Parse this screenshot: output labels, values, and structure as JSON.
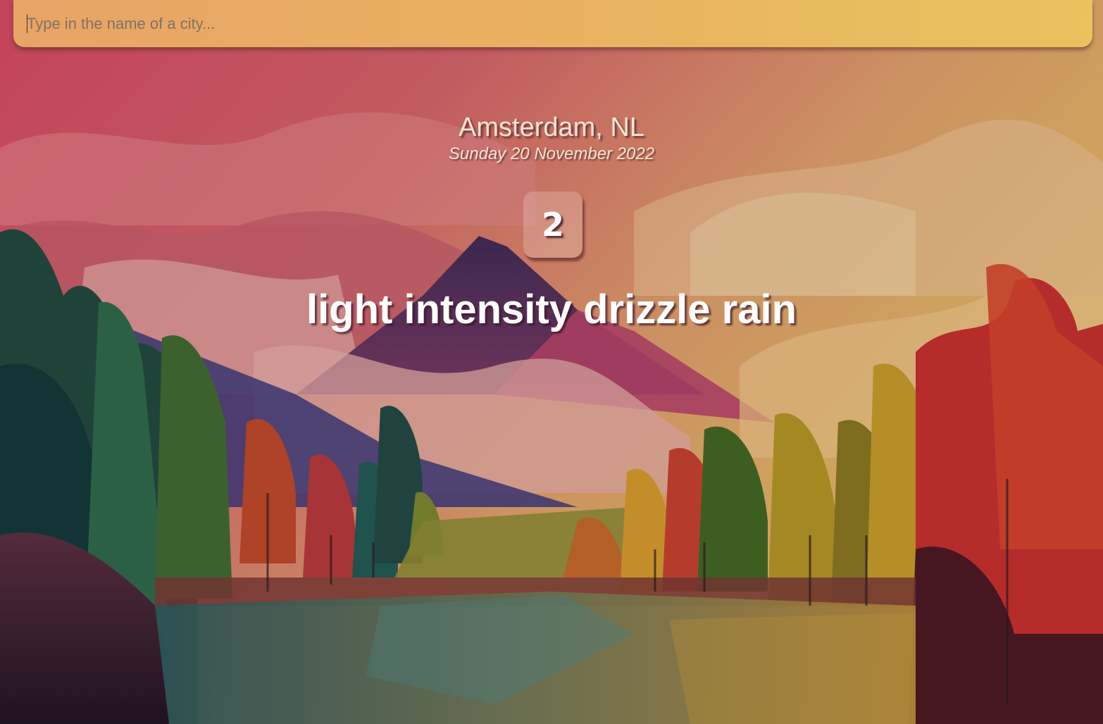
{
  "search": {
    "placeholder": "Type in the name of a city..."
  },
  "weather": {
    "location": "Amsterdam, NL",
    "date": "Sunday 20 November 2022",
    "temperature": "2",
    "description": "light intensity drizzle rain"
  },
  "colors": {
    "search_bar_left": "#e8a466",
    "search_bar_right": "#e8c35e",
    "text_light": "#f4e4cf",
    "text_white": "#ffffff"
  },
  "background": {
    "scene": "autumn-mountain-lake-illustration"
  }
}
